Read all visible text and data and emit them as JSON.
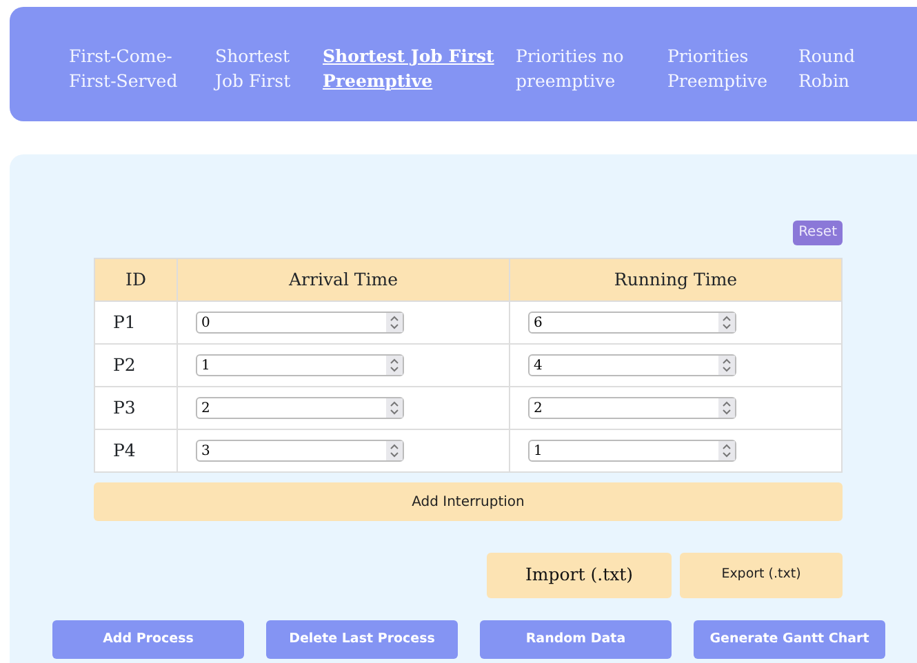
{
  "nav": {
    "items": [
      {
        "label": "First-Come-First-Served",
        "selected": false
      },
      {
        "label": "Shortest Job First",
        "selected": false
      },
      {
        "label": "Shortest Job First Preemptive",
        "selected": true
      },
      {
        "label": "Priorities no preemptive",
        "selected": false
      },
      {
        "label": "Priorities Preemptive",
        "selected": false
      },
      {
        "label": "Round Robin",
        "selected": false
      }
    ]
  },
  "reset_button": "Reset",
  "table": {
    "columns": [
      "ID",
      "Arrival Time",
      "Running Time"
    ],
    "rows": [
      {
        "id": "P1",
        "arrival": "0",
        "running": "6"
      },
      {
        "id": "P2",
        "arrival": "1",
        "running": "4"
      },
      {
        "id": "P3",
        "arrival": "2",
        "running": "2"
      },
      {
        "id": "P4",
        "arrival": "3",
        "running": "1"
      }
    ]
  },
  "add_interruption": "Add Interruption",
  "import_button": "Import (.txt)",
  "export_button": "Export (.txt)",
  "actions": [
    "Add Process",
    "Delete Last Process",
    "Random Data",
    "Generate Gantt Chart"
  ]
}
